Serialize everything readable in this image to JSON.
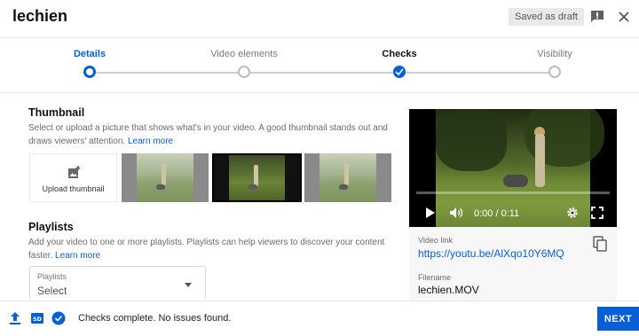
{
  "header": {
    "title": "lechien",
    "draft_status": "Saved as draft",
    "feedback_icon": "feedback-icon",
    "close_icon": "close-icon"
  },
  "stepper": {
    "steps": [
      {
        "label": "Details",
        "state": "current"
      },
      {
        "label": "Video elements",
        "state": "pending"
      },
      {
        "label": "Checks",
        "state": "done"
      },
      {
        "label": "Visibility",
        "state": "pending"
      }
    ]
  },
  "thumbnail": {
    "title": "Thumbnail",
    "description": "Select or upload a picture that shows what's in your video. A good thumbnail stands out and draws viewers' attention.",
    "learn_more": "Learn more",
    "upload_label": "Upload thumbnail",
    "options": [
      "thumbnail-1",
      "thumbnail-2",
      "thumbnail-3"
    ],
    "selected_index": 1
  },
  "playlists": {
    "title": "Playlists",
    "description": "Add your video to one or more playlists. Playlists can help viewers to discover your content faster.",
    "learn_more": "Learn more",
    "field_label": "Playlists",
    "field_value": "Select"
  },
  "preview": {
    "time": "0:00 / 0:11",
    "video_link_label": "Video link",
    "video_link": "https://youtu.be/AlXqo10Y6MQ",
    "filename_label": "Filename",
    "filename": "lechien.MOV"
  },
  "footer": {
    "status": "Checks complete. No issues found.",
    "next_label": "NEXT"
  },
  "colors": {
    "accent": "#065fd4",
    "text": "#0d0d0d",
    "muted": "#6b6b6b"
  }
}
